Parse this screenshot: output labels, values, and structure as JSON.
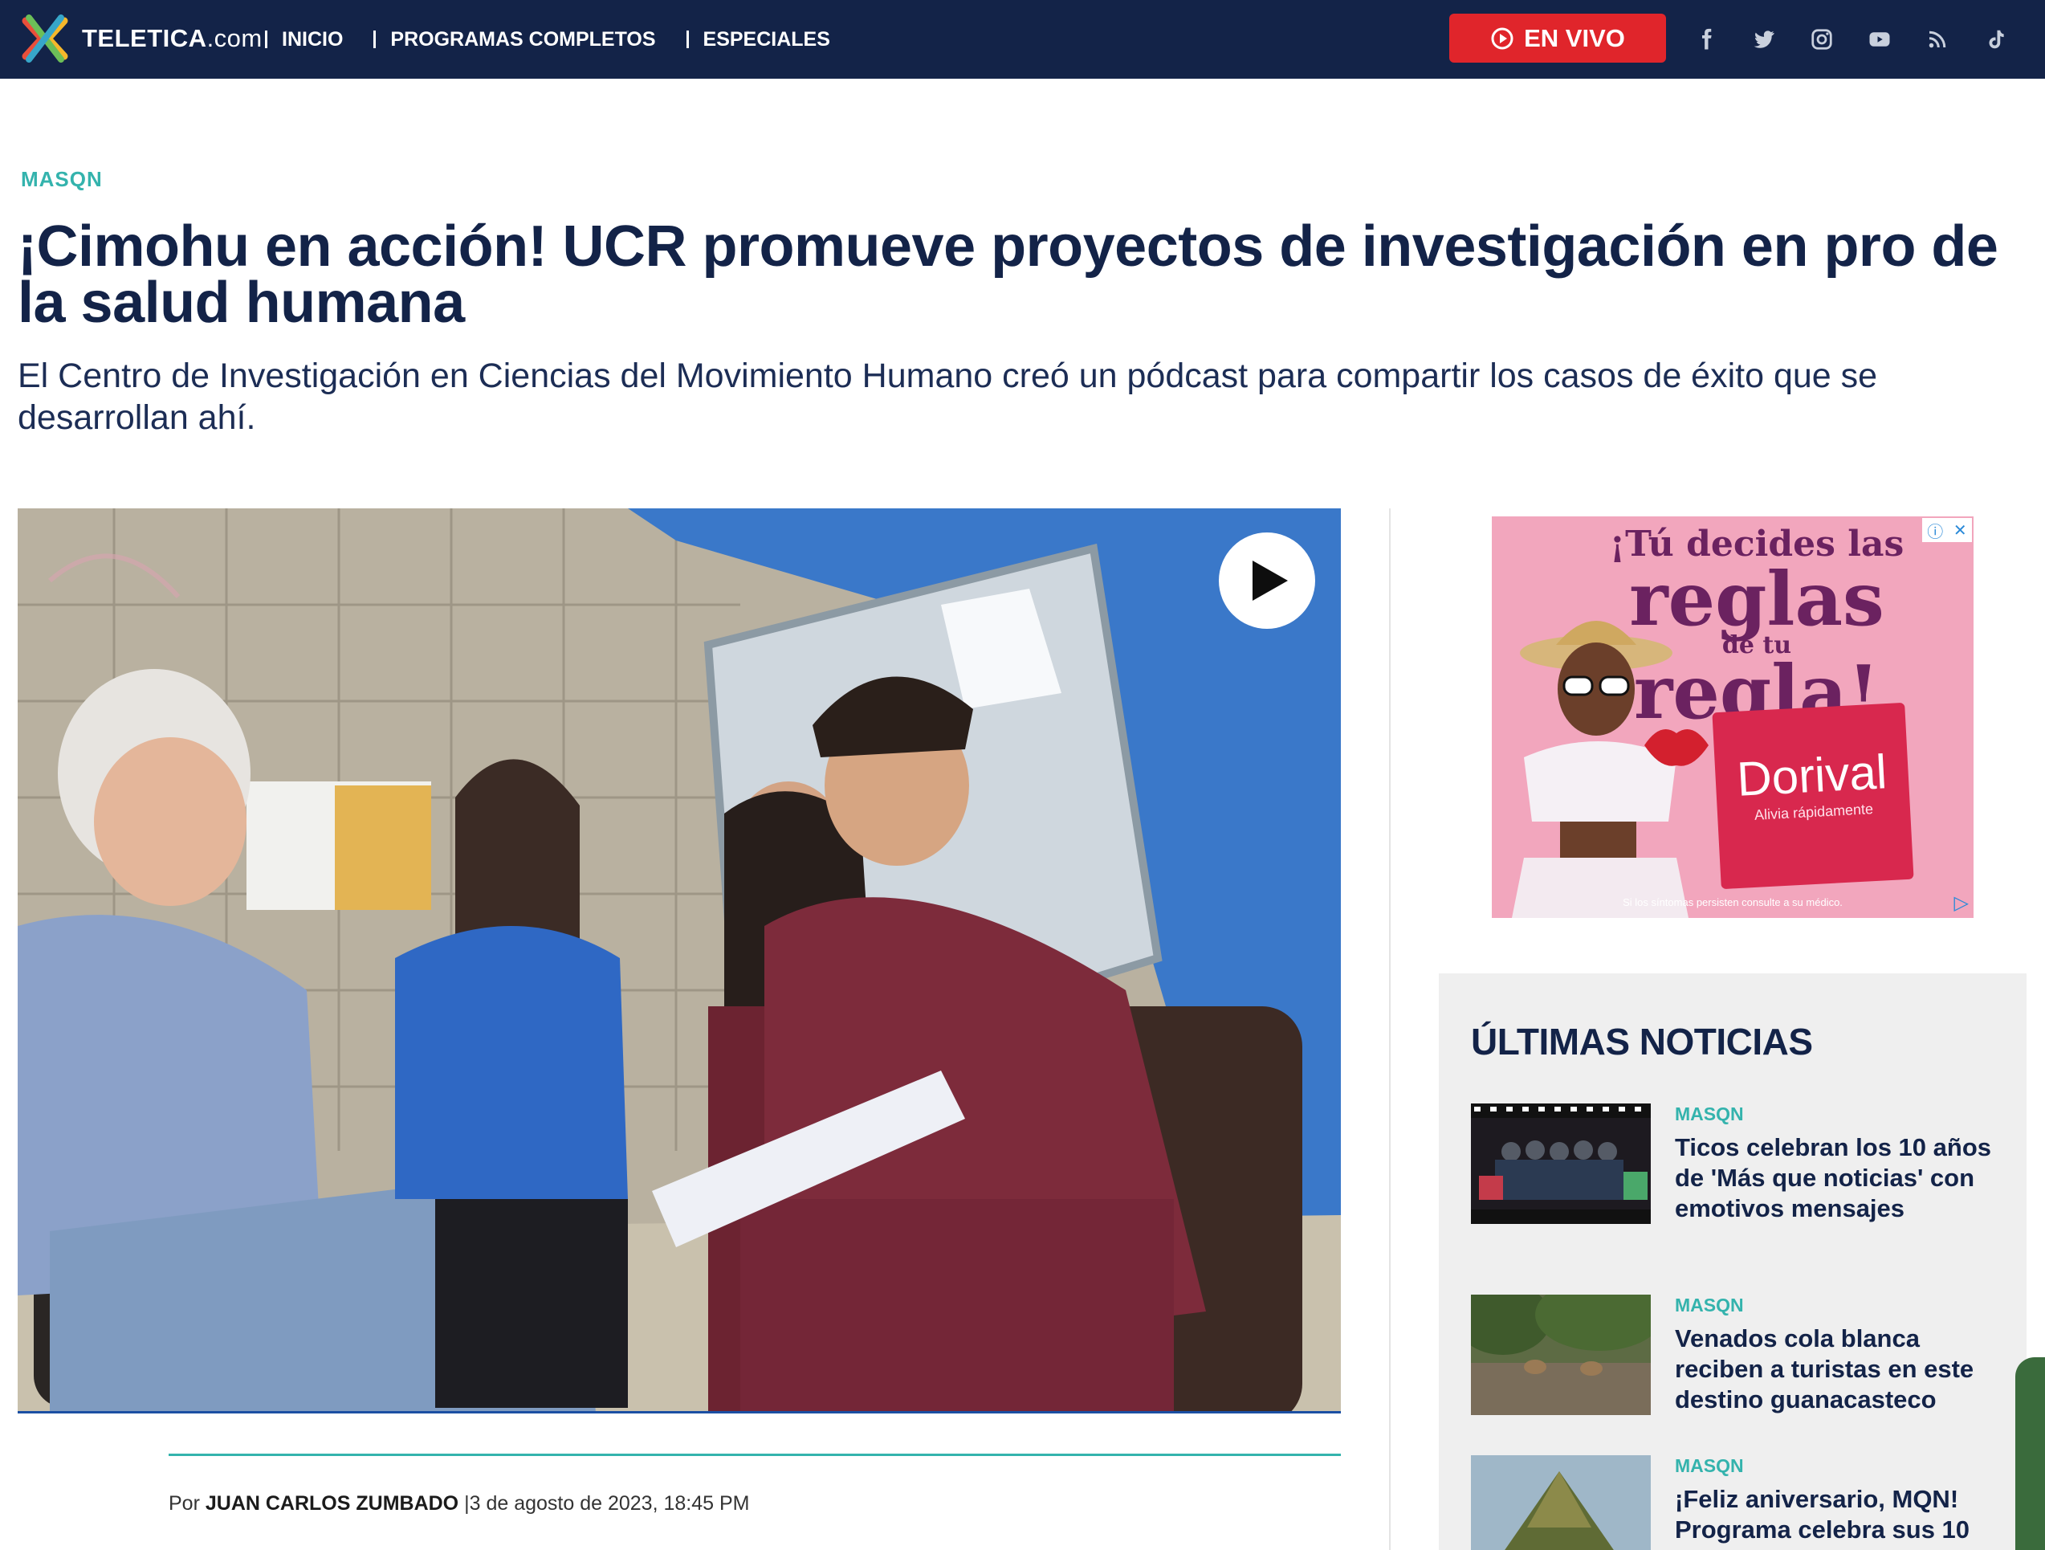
{
  "header": {
    "logo_text_bold": "TELETICA",
    "logo_text_light": ".com",
    "nav": [
      {
        "label": "INICIO"
      },
      {
        "label": "PROGRAMAS COMPLETOS"
      },
      {
        "label": "ESPECIALES"
      }
    ],
    "live_label": "EN VIVO",
    "social_icons": [
      "facebook-icon",
      "twitter-icon",
      "instagram-icon",
      "youtube-icon",
      "rss-icon",
      "tiktok-icon"
    ]
  },
  "article": {
    "category": "MASQN",
    "title": "¡Cimohu en acción! UCR promueve proyectos de investigación en pro de la salud humana",
    "subtitle": "El Centro de Investigación en Ciencias del Movimiento Humano creó un pódcast para compartir los casos de éxito que se desarrollan ahí.",
    "byline_prefix": "Por",
    "author": "JUAN CARLOS ZUMBADO",
    "date": "|3 de agosto de 2023, 18:45 PM"
  },
  "ad": {
    "line1": "¡Tú decides las",
    "line2": "reglas",
    "line3": "de tu",
    "line4": "regla!",
    "brand": "Dorival",
    "product_note": "Alivia rápidamente",
    "footer": "Si los síntomas persisten consulte a su médico."
  },
  "latest": {
    "title": "ÚLTIMAS NOTICIAS",
    "items": [
      {
        "category": "MASQN",
        "headline": "Ticos celebran los 10 años de 'Más que noticias' con emotivos mensajes"
      },
      {
        "category": "MASQN",
        "headline": "Venados cola blanca reciben a turistas en este destino guanacasteco"
      },
      {
        "category": "MASQN",
        "headline": "¡Feliz aniversario, MQN! Programa celebra sus 10"
      }
    ]
  },
  "colors": {
    "navbar": "#132348",
    "accent": "#34b3ad",
    "live": "#e0252b",
    "headline": "#132348"
  }
}
